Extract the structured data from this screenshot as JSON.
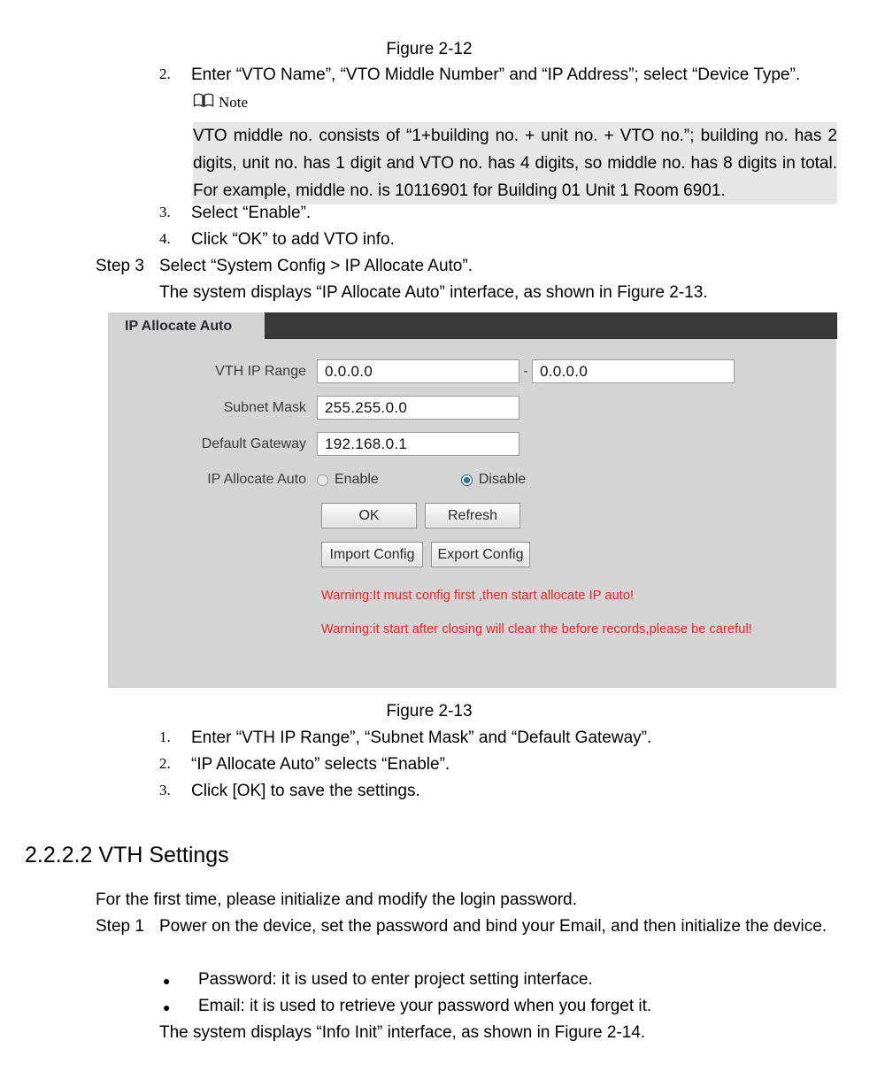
{
  "figure_top": {
    "caption": "Figure 2-12"
  },
  "steps_upper": [
    {
      "num": "2.",
      "text": "Enter “VTO Name”, “VTO Middle Number” and “IP Address”; select “Device Type”."
    },
    {
      "num": "3.",
      "text": "Select “Enable”."
    },
    {
      "num": "4.",
      "text": "Click “OK” to add VTO info."
    }
  ],
  "note": {
    "icon": "open-book-icon",
    "label": "Note",
    "body": "VTO middle no. consists of “1+building no. + unit no. + VTO no.”; building no. has 2 digits, unit no. has 1 digit and VTO no. has 4 digits, so middle no. has 8 digits in total. For example, middle no. is 10116901 for Building 01 Unit 1 Room 6901."
  },
  "step3": {
    "label": "Step 3",
    "text": "Select “System Config > IP Allocate Auto”.",
    "follow": "The system displays “IP Allocate Auto” interface, as shown in Figure 2-13."
  },
  "ui_panel": {
    "tab_label": "IP Allocate Auto",
    "fields": [
      {
        "label": "VTH IP Range",
        "value": "0.0.0.0",
        "value2": "0.0.0.0",
        "separator": "-"
      },
      {
        "label": "Subnet Mask",
        "value": "255.255.0.0"
      },
      {
        "label": "Default Gateway",
        "value": "192.168.0.1"
      }
    ],
    "radio_group": {
      "label": "IP Allocate Auto",
      "options": [
        {
          "label": "Enable",
          "selected": false
        },
        {
          "label": "Disable",
          "selected": true
        }
      ]
    },
    "buttons": [
      {
        "label": "OK"
      },
      {
        "label": "Refresh"
      },
      {
        "label": "Import Config"
      },
      {
        "label": "Export Config"
      }
    ],
    "warnings": [
      "Warning:It must config first ,then start allocate IP auto!",
      "Warning:it start after closing will clear the before records,please be careful!"
    ],
    "colors": {
      "panel_bg": "#d4d4d4",
      "tab_bar_dark": "#3a3a3a",
      "warning_red": "#f02020",
      "radio_accent": "#2f7fb5",
      "input_bg": "#ffffff"
    }
  },
  "figure_bottom": {
    "caption": "Figure 2-13"
  },
  "steps_lower": [
    {
      "num": "1.",
      "text": "Enter “VTH IP Range”, “Subnet Mask” and “Default Gateway”."
    },
    {
      "num": "2.",
      "text": "“IP Allocate Auto” selects “Enable”."
    },
    {
      "num": "3.",
      "text": "Click [OK] to save the settings."
    }
  ],
  "section": {
    "heading": "2.2.2.2 VTH Settings",
    "intro": "For the first time, please initialize and modify the login password.",
    "step1_label": "Step 1",
    "step1_text": "Power on the device, set the password and bind your Email, and then initialize the device.",
    "bullets": [
      "Password: it is used to enter project setting interface.",
      "Email: it is used to retrieve your password when you forget it."
    ],
    "closing": "The system displays “Info Init” interface, as shown in Figure 2-14."
  }
}
